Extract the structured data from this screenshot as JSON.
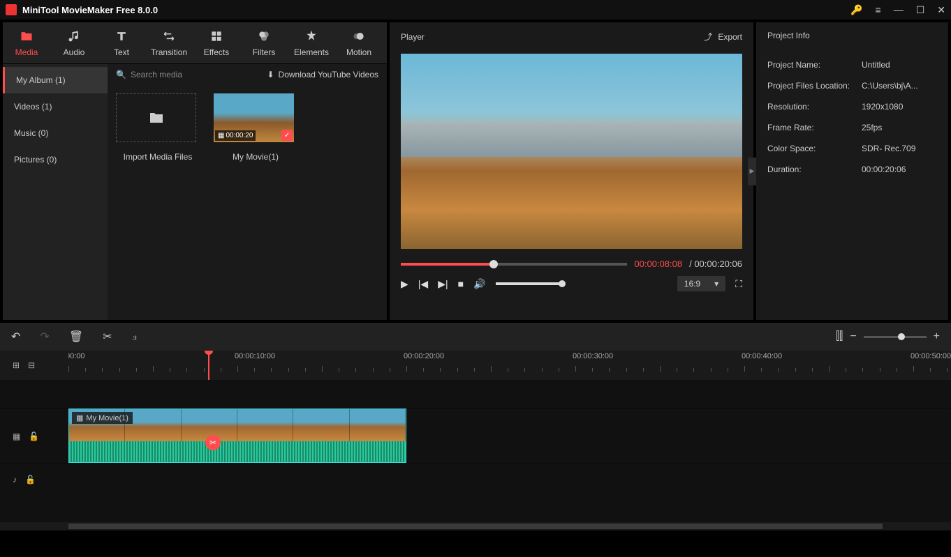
{
  "titlebar": {
    "title": "MiniTool MovieMaker Free 8.0.0"
  },
  "tabs": [
    {
      "label": "Media"
    },
    {
      "label": "Audio"
    },
    {
      "label": "Text"
    },
    {
      "label": "Transition"
    },
    {
      "label": "Effects"
    },
    {
      "label": "Filters"
    },
    {
      "label": "Elements"
    },
    {
      "label": "Motion"
    }
  ],
  "sidebar": {
    "items": [
      {
        "label": "My Album (1)"
      },
      {
        "label": "Videos (1)"
      },
      {
        "label": "Music (0)"
      },
      {
        "label": "Pictures (0)"
      }
    ]
  },
  "media": {
    "search_placeholder": "Search media",
    "download_label": "Download YouTube Videos",
    "import_label": "Import Media Files",
    "clip_duration": "00:00:20",
    "clip_name": "My Movie(1)"
  },
  "player": {
    "title": "Player",
    "export_label": "Export",
    "current_time": "00:00:08:08",
    "total_time": "00:00:20:06",
    "separator": " / ",
    "aspect": "16:9"
  },
  "info": {
    "title": "Project Info",
    "rows": [
      {
        "k": "Project Name:",
        "v": "Untitled"
      },
      {
        "k": "Project Files Location:",
        "v": "C:\\Users\\bj\\A..."
      },
      {
        "k": "Resolution:",
        "v": "1920x1080"
      },
      {
        "k": "Frame Rate:",
        "v": "25fps"
      },
      {
        "k": "Color Space:",
        "v": "SDR- Rec.709"
      },
      {
        "k": "Duration:",
        "v": "00:00:20:06"
      }
    ]
  },
  "timeline": {
    "ruler": [
      "00:00",
      "00:00:10:00",
      "00:00:20:00",
      "00:00:30:00",
      "00:00:40:00",
      "00:00:50:00"
    ],
    "clip_label": "My Movie(1)"
  }
}
